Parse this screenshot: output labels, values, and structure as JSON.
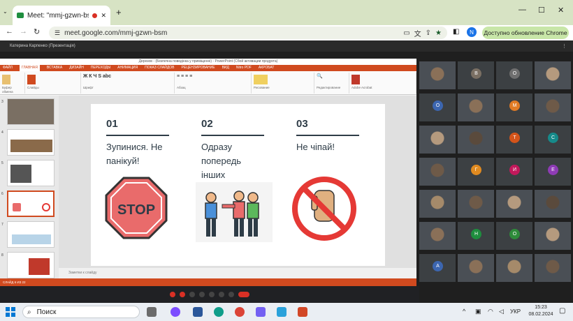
{
  "browser": {
    "tab_title": "Meet: \"mmj-gzwn-bsm\"",
    "url": "meet.google.com/mmj-gzwn-bsm",
    "update_label": "Доступно обновление Chrome",
    "profile_initial": "N"
  },
  "meet": {
    "bar_text": "Катерина Карпенко (Презентація)"
  },
  "ppt": {
    "title": "Дерезов - (Безпечна поведінка у приміщенні) - PowerPoint (Сбой активации продукта)",
    "menu": [
      "ФАЙЛ",
      "ГЛАВНАЯ",
      "ВСТАВКА",
      "ДИЗАЙН",
      "ПЕРЕХОДЫ",
      "АНИМАЦИЯ",
      "ПОКАЗ СЛАЙДОВ",
      "РЕЦЕНЗИРОВАНИЕ",
      "ВИД",
      "Nitro PDF",
      "АКРОБАТ"
    ],
    "ribbon_groups": [
      "Буфер обмена",
      "Слайды",
      "Шрифт",
      "Абзац",
      "Рисование",
      "Редактирование",
      "Adobe Acrobat"
    ],
    "thumb_nums": [
      "3",
      "4",
      "5",
      "6",
      "7",
      "8"
    ],
    "notes": "Заметки к слайду",
    "status": "СЛАЙД 6 ИЗ 22"
  },
  "slide": {
    "items": [
      {
        "num": "01",
        "text_lines": [
          "Зупинися. Не",
          "панікуй!"
        ]
      },
      {
        "num": "02",
        "text_lines": [
          "Одразу",
          "попередь",
          "інших"
        ]
      },
      {
        "num": "03",
        "text_lines": [
          "Не чіпай!"
        ]
      }
    ],
    "stop_sign_text": "STOP"
  },
  "participants": [
    {
      "type": "video"
    },
    {
      "type": "avatar",
      "letter": "В",
      "color": "#7a6f63"
    },
    {
      "type": "avatar",
      "letter": "О",
      "color": "#6f6f6f"
    },
    {
      "type": "video"
    },
    {
      "type": "avatar",
      "letter": "О",
      "color": "#3c66b0"
    },
    {
      "type": "video"
    },
    {
      "type": "avatar",
      "letter": "М",
      "color": "#e07b25"
    },
    {
      "type": "video"
    },
    {
      "type": "video"
    },
    {
      "type": "video"
    },
    {
      "type": "avatar",
      "letter": "Т",
      "color": "#d4541a"
    },
    {
      "type": "avatar",
      "letter": "С",
      "color": "#168a8a"
    },
    {
      "type": "video"
    },
    {
      "type": "avatar",
      "letter": "Г",
      "color": "#e08a20"
    },
    {
      "type": "avatar",
      "letter": "И",
      "color": "#c2185b"
    },
    {
      "type": "avatar",
      "letter": "Е",
      "color": "#8e3bb5"
    },
    {
      "type": "video"
    },
    {
      "type": "video"
    },
    {
      "type": "video"
    },
    {
      "type": "video"
    },
    {
      "type": "video"
    },
    {
      "type": "avatar",
      "letter": "Н",
      "color": "#1e8e3e"
    },
    {
      "type": "avatar",
      "letter": "О",
      "color": "#2e8b3a"
    },
    {
      "type": "video"
    },
    {
      "type": "avatar",
      "letter": "А",
      "color": "#3c66b0"
    },
    {
      "type": "video"
    },
    {
      "type": "video"
    },
    {
      "type": "video"
    }
  ],
  "taskbar": {
    "search_placeholder": "Поиск",
    "lang": "УКР",
    "time": "15:23",
    "date": "08.02.2024"
  },
  "colors": {
    "ppt_accent": "#d04a1f",
    "stop_red": "#e96b6b",
    "nohand_red": "#e53935"
  }
}
